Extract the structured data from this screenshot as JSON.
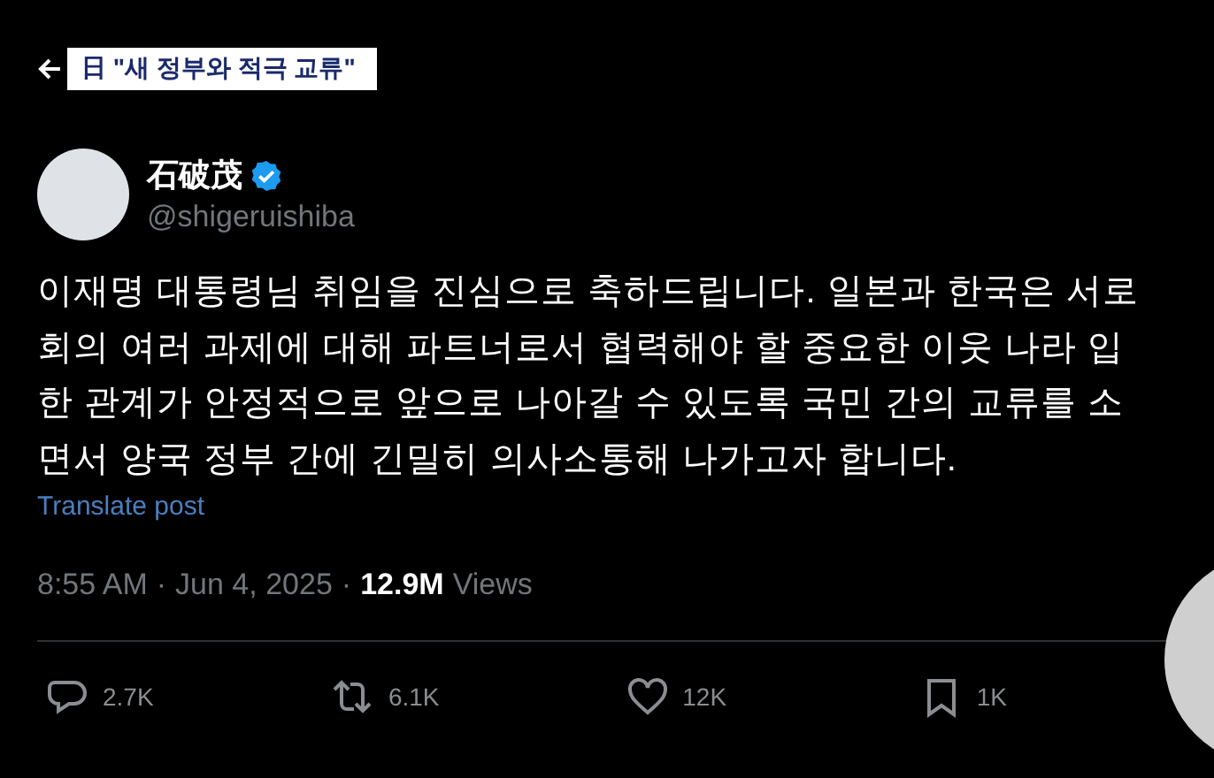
{
  "caption": "日 \"새 정부와 적극 교류\"",
  "author": {
    "name": "石破茂",
    "verified": true,
    "handle": "@shigeruishiba"
  },
  "body_lines": [
    "이재명 대통령님 취임을 진심으로 축하드립니다. 일본과 한국은 서로",
    "회의 여러 과제에 대해 파트너로서 협력해야 할 중요한 이웃 나라 입",
    "한 관계가 안정적으로 앞으로 나아갈 수 있도록 국민 간의 교류를 소",
    "면서 양국 정부 간에 긴밀히 의사소통해 나가고자 합니다."
  ],
  "translate_link": "Translate post",
  "meta": {
    "time": "8:55 AM",
    "separator": "·",
    "date": "Jun 4, 2025",
    "views_count": "12.9M",
    "views_label": "Views"
  },
  "actions": [
    {
      "kind": "reply",
      "count": "2.7K"
    },
    {
      "kind": "repost",
      "count": "6.1K"
    },
    {
      "kind": "like",
      "count": "12K"
    },
    {
      "kind": "bookmark",
      "count": "1K"
    }
  ]
}
